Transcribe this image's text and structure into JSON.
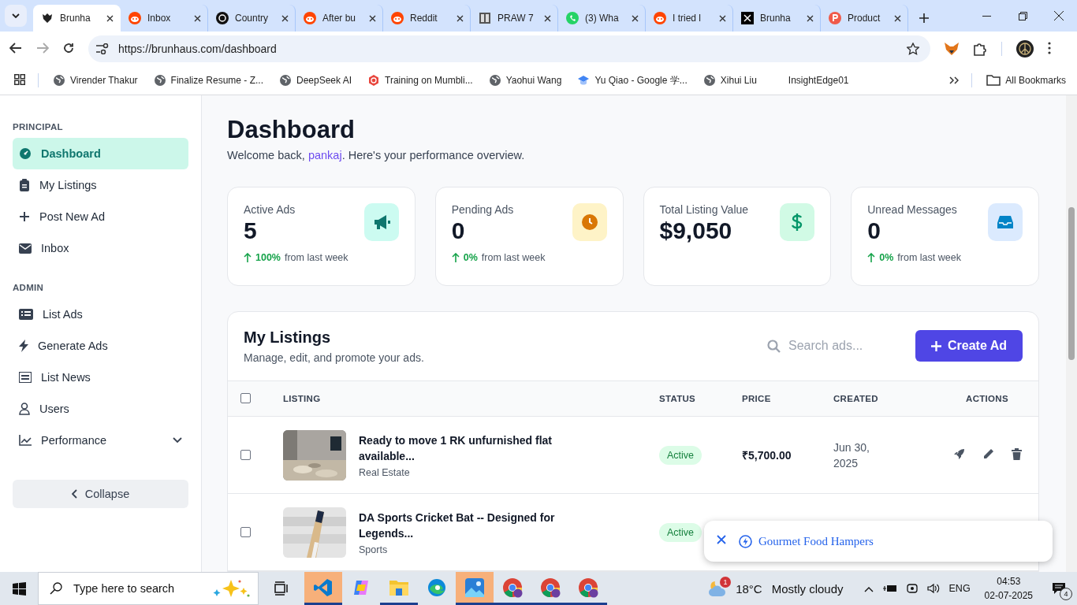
{
  "browser": {
    "tabs": [
      {
        "title": "Brunha",
        "kind": "crest",
        "selected": true
      },
      {
        "title": "Inbox",
        "kind": "reddit",
        "selected": false
      },
      {
        "title": "Country",
        "kind": "openai",
        "selected": false
      },
      {
        "title": "After bu",
        "kind": "reddit",
        "selected": false
      },
      {
        "title": "Reddit",
        "kind": "reddit",
        "selected": false
      },
      {
        "title": "PRAW 7",
        "kind": "doc",
        "selected": false
      },
      {
        "title": "(3) Wha",
        "kind": "whatsapp",
        "selected": false
      },
      {
        "title": "I tried l",
        "kind": "reddit",
        "selected": false
      },
      {
        "title": "Brunha",
        "kind": "x",
        "selected": false
      },
      {
        "title": "Product",
        "kind": "p",
        "selected": false
      }
    ],
    "url": "https://brunhaus.com/dashboard",
    "bookmarks": [
      {
        "label": "Virender Thakur",
        "kind": "globe"
      },
      {
        "label": "Finalize Resume - Z...",
        "kind": "globe"
      },
      {
        "label": "DeepSeek AI",
        "kind": "globe"
      },
      {
        "label": "Training on Mumbli...",
        "kind": "hex"
      },
      {
        "label": "Yaohui Wang",
        "kind": "globe"
      },
      {
        "label": "Yu Qiao - Google 学...",
        "kind": "cap"
      },
      {
        "label": "Xihui Liu",
        "kind": "globe"
      },
      {
        "label": "InsightEdge01",
        "kind": "none"
      }
    ],
    "all_bookmarks": "All Bookmarks"
  },
  "sidebar": {
    "sections": [
      {
        "heading": "PRINCIPAL",
        "items": [
          {
            "label": "Dashboard",
            "kind": "gauge",
            "selected": true
          },
          {
            "label": "My Listings",
            "kind": "clipboard",
            "selected": false
          },
          {
            "label": "Post New Ad",
            "kind": "plus",
            "selected": false
          },
          {
            "label": "Inbox",
            "kind": "envelope",
            "selected": false
          }
        ]
      },
      {
        "heading": "ADMIN",
        "items": [
          {
            "label": "List Ads",
            "kind": "list",
            "selected": false
          },
          {
            "label": "Generate Ads",
            "kind": "bolt",
            "selected": false
          },
          {
            "label": "List News",
            "kind": "news",
            "selected": false
          },
          {
            "label": "Users",
            "kind": "user",
            "selected": false
          },
          {
            "label": "Performance",
            "kind": "chart",
            "selected": false,
            "expanded": false
          }
        ]
      }
    ],
    "collapse": "Collapse"
  },
  "header": {
    "title": "Dashboard",
    "welcome": "Welcome back, ",
    "user": "pankaj",
    "welcome_tail": ". Here's your performance overview."
  },
  "stats": [
    {
      "label": "Active Ads",
      "value": "5",
      "kind": "megaphone",
      "change": "100%",
      "change_note": "from last week"
    },
    {
      "label": "Pending Ads",
      "value": "0",
      "kind": "clock",
      "change": "0%",
      "change_note": "from last week"
    },
    {
      "label": "Total Listing Value",
      "value": "$9,050",
      "kind": "dollar"
    },
    {
      "label": "Unread Messages",
      "value": "0",
      "kind": "inbox",
      "change": "0%",
      "change_note": "from last week"
    }
  ],
  "listings": {
    "title": "My Listings",
    "subtitle": "Manage, edit, and promote your ads.",
    "search": {
      "placeholder": "Search ads..."
    },
    "create": "Create Ad",
    "select_all": {
      "checked": false
    },
    "columns": [
      "LISTING",
      "STATUS",
      "PRICE",
      "CREATED",
      "ACTIONS"
    ],
    "rows": [
      {
        "checked": false,
        "title": "Ready to move 1 RK unfurnished flat available...",
        "category": "Real Estate",
        "status": "Active",
        "price": "₹5,700.00",
        "created": "Jun 30, 2025",
        "kind": "picture"
      },
      {
        "checked": false,
        "title": "DA Sports Cricket Bat -- Designed for Legends...",
        "category": "Sports",
        "status": "Active",
        "kind": "picture"
      }
    ]
  },
  "toast": {
    "text": "Gourmet Food Hampers"
  },
  "taskbar": {
    "search": {
      "placeholder": "Type here to search"
    },
    "apps": [
      {
        "kind": "vscode",
        "highlighted": true,
        "running": true
      },
      {
        "kind": "copilot",
        "highlighted": false,
        "running": false
      },
      {
        "kind": "folder",
        "highlighted": false,
        "running": true
      },
      {
        "kind": "edge",
        "highlighted": false,
        "running": false
      },
      {
        "kind": "photos",
        "highlighted": true,
        "running": true
      },
      {
        "kind": "chrome",
        "highlighted": false,
        "running": true
      },
      {
        "kind": "chrome",
        "highlighted": false,
        "running": true
      },
      {
        "kind": "chrome",
        "highlighted": false,
        "running": true
      }
    ],
    "weather": {
      "badge": "1",
      "temp": "18°C",
      "text": "Mostly cloudy"
    },
    "language": "ENG",
    "time": "04:53",
    "date": "02-07-2025",
    "notifications": "4"
  }
}
